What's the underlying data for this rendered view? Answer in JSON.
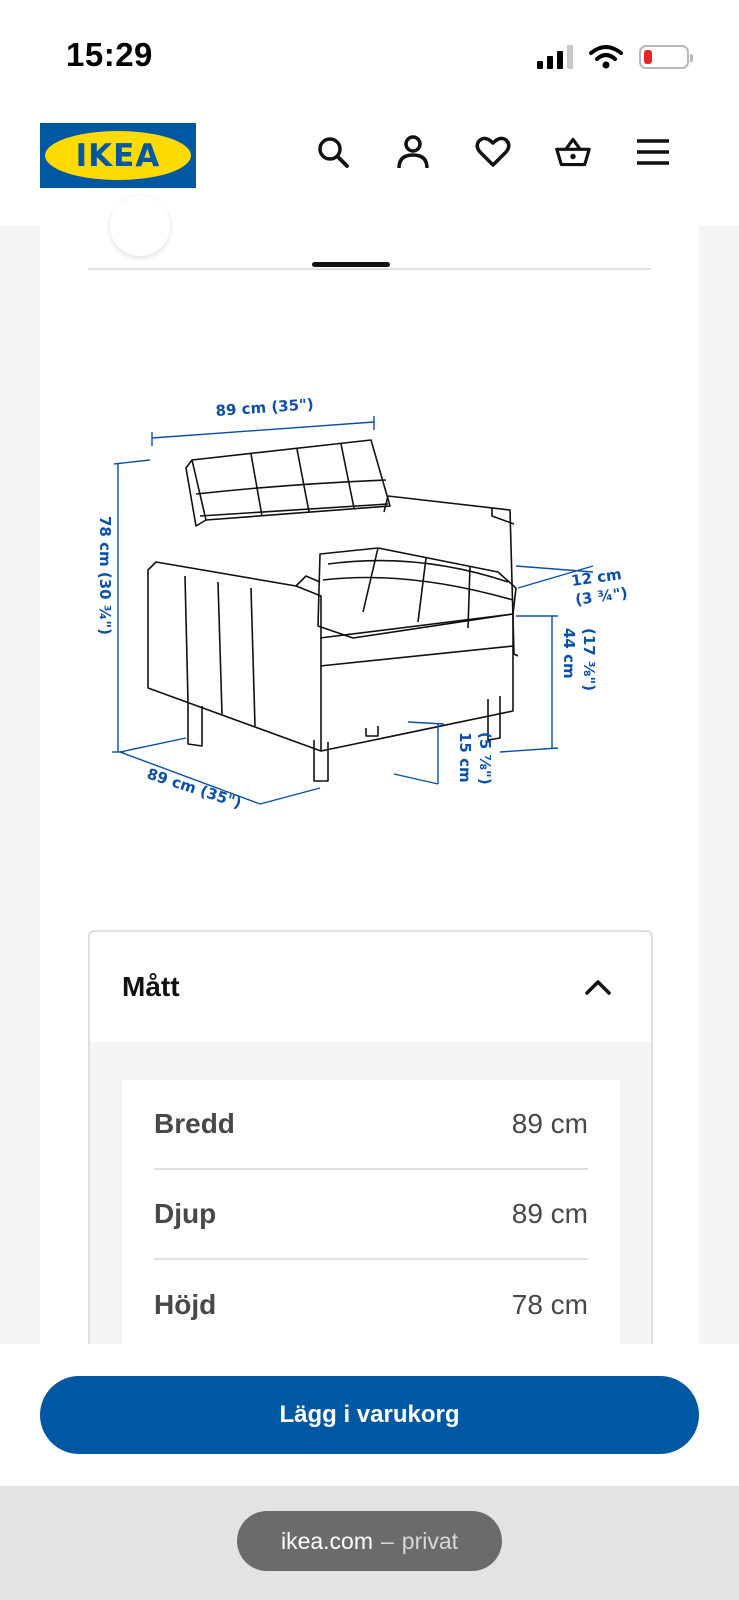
{
  "status_bar": {
    "time": "15:29",
    "icons": [
      "signal-icon",
      "wifi-icon",
      "battery-low-icon"
    ],
    "battery_color": "#e8232a"
  },
  "header": {
    "logo_text": "IKEA",
    "icons": [
      "search-icon",
      "user-icon",
      "heart-icon",
      "basket-icon",
      "menu-icon"
    ],
    "brand_blue": "#0058a3",
    "brand_yellow": "#ffdb00"
  },
  "drawing": {
    "width_top": "89 cm (35\")",
    "height": "78 cm (30 ¾\")",
    "depth": "89 cm (35\")",
    "arm_height_a": "12 cm",
    "arm_height_b": "(3 ¾\")",
    "seat_height_a": "44 cm",
    "seat_height_b": "(17 ⅜\")",
    "leg_height_a": "15 cm",
    "leg_height_b": "(5 ⅞\")",
    "dimension_color": "#0a4fa8"
  },
  "dimensions_section": {
    "title": "Mått",
    "rows": [
      {
        "label": "Bredd",
        "value": "89 cm"
      },
      {
        "label": "Djup",
        "value": "89 cm"
      },
      {
        "label": "Höjd",
        "value": "78 cm"
      }
    ]
  },
  "cta": {
    "label": "Lägg i varukorg"
  },
  "browser": {
    "domain": "ikea.com",
    "separator": "–",
    "mode": "privat"
  }
}
